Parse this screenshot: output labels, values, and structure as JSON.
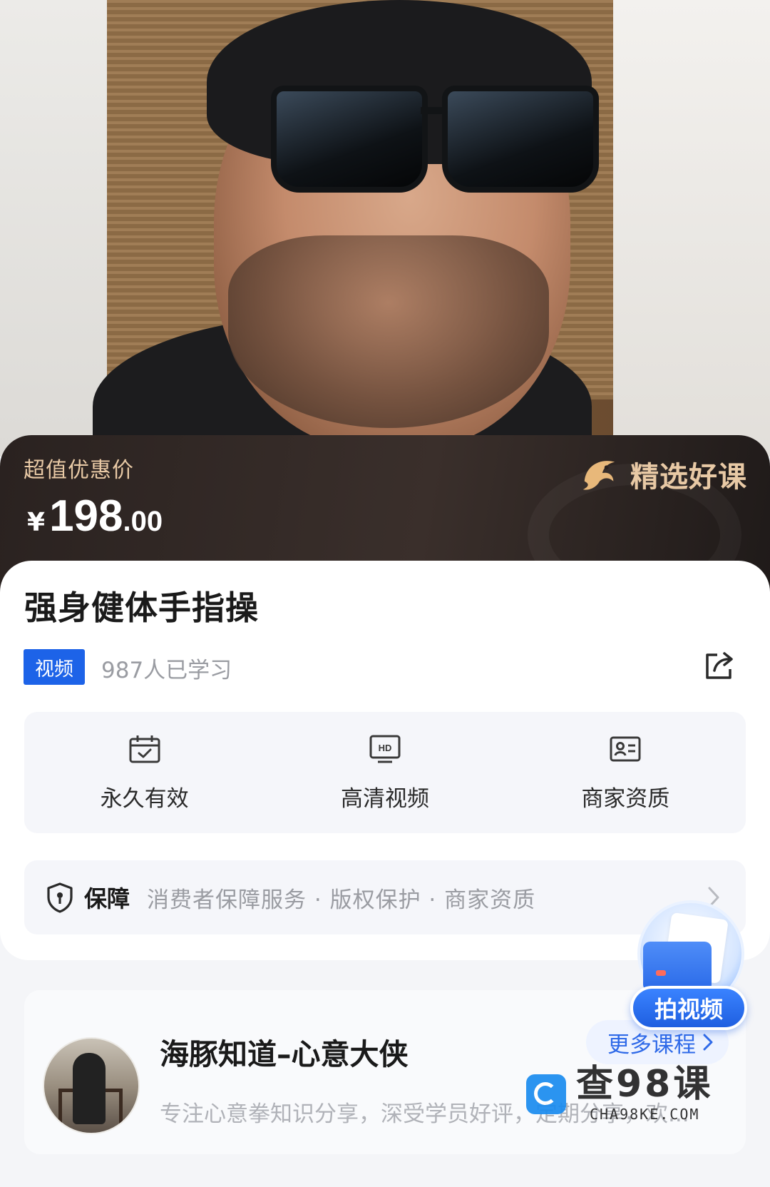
{
  "price": {
    "label": "超值优惠价",
    "currency": "¥",
    "integer": "198",
    "decimal": ".00",
    "badge": "精选好课"
  },
  "course": {
    "title": "强身健体手指操",
    "tag": "视频",
    "learners": "987人已学习"
  },
  "features": [
    {
      "label": "永久有效",
      "icon": "calendar-check-icon"
    },
    {
      "label": "高清视频",
      "icon": "hd-video-icon"
    },
    {
      "label": "商家资质",
      "icon": "id-card-icon"
    }
  ],
  "guarantee": {
    "title": "保障",
    "text": "消费者保障服务 · 版权保护 · 商家资质"
  },
  "fab": {
    "label": "拍视频"
  },
  "author": {
    "name": "海豚知道–心意大侠",
    "description": "专注心意拳知识分享，深受学员好评，定期分享，欢...",
    "more_label": "更多课程"
  },
  "watermark": {
    "main": "查98课",
    "sub": "CHA98KE.COM"
  },
  "colors": {
    "accent_blue": "#1d63e8",
    "price_gold": "#e8c9a5",
    "banner_dark": "#2a2220"
  }
}
